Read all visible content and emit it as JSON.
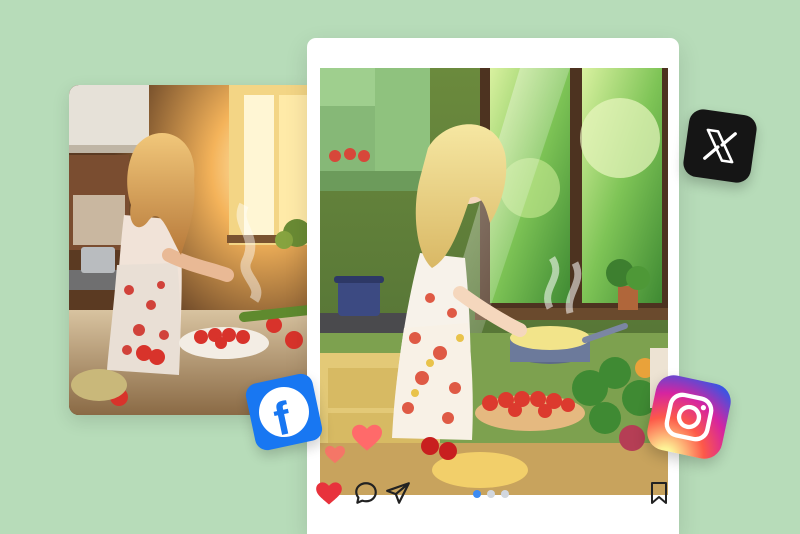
{
  "photo": {
    "subject": "woman-cooking-in-kitchen-photo"
  },
  "post": {
    "image_subject": "anime-style-woman-cooking-illustration",
    "carousel": {
      "count": 3,
      "active_index": 0
    },
    "actions": [
      "like-icon",
      "comment-icon",
      "share-icon",
      "bookmark-icon"
    ],
    "like_color": "#e8323c"
  },
  "social": {
    "facebook": {
      "letter": "f",
      "color": "#1877f2"
    },
    "x": {
      "color": "#151515"
    },
    "instagram": {
      "colors": [
        "#fdf497",
        "#fd5949",
        "#d6249f",
        "#285AEB"
      ]
    }
  },
  "colors": {
    "background": "#b7dcb9",
    "card": "#ffffff",
    "dot_active": "#3d8bf2",
    "dot_inactive": "#d2d7de"
  }
}
